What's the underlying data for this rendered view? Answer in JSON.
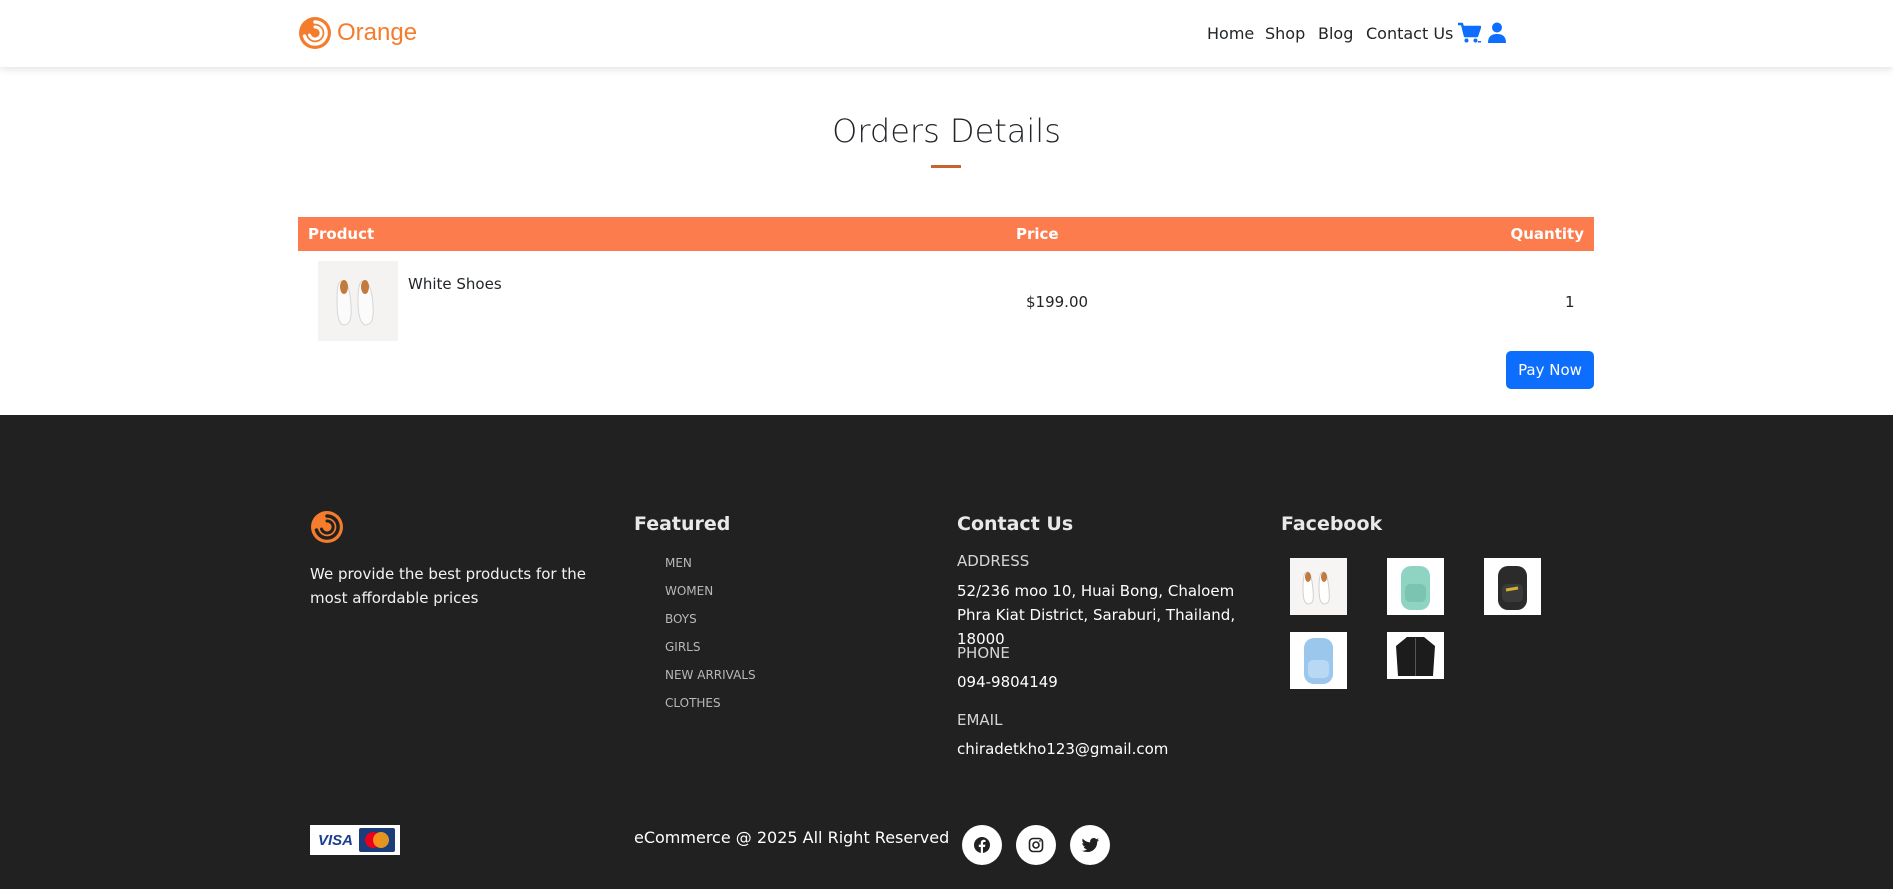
{
  "navbar": {
    "brand": "Orange",
    "links": [
      "Home",
      "Shop",
      "Blog",
      "Contact Us"
    ],
    "icons": [
      "cart-icon",
      "user-icon"
    ],
    "accent_color": "#f47c2c",
    "link_color": "#0d6efd"
  },
  "page": {
    "title": "Orders Details"
  },
  "table": {
    "headers": {
      "product": "Product",
      "price": "Price",
      "quantity": "Quantity"
    },
    "header_color": "#fd7c4d",
    "rows": [
      {
        "product": "White Shoes",
        "price": "$199.00",
        "quantity": "1"
      }
    ],
    "pay_button": "Pay Now"
  },
  "footer": {
    "background": "#212121",
    "description": "We provide the best products for the most affordable prices",
    "featured": {
      "heading": "Featured",
      "items": [
        "MEN",
        "WOMEN",
        "BOYS",
        "GIRLS",
        "NEW ARRIVALS",
        "CLOTHES"
      ]
    },
    "contact": {
      "heading": "Contact Us",
      "address_label": "ADDRESS",
      "address": "52/236 moo 10, Huai Bong, Chaloem Phra Kiat District, Saraburi, Thailand, 18000",
      "phone_label": "PHONE",
      "phone": "094-9804149",
      "email_label": "EMAIL",
      "email": "chiradetkho123@gmail.com"
    },
    "facebook": {
      "heading": "Facebook",
      "thumbnails": [
        "white-shoes",
        "mint-backpack",
        "black-backpack",
        "light-blue-backpack",
        "black-jacket"
      ]
    },
    "copyright": "eCommerce @ 2025 All Right Reserved",
    "social": [
      "facebook-icon",
      "instagram-icon",
      "twitter-icon"
    ],
    "payment_cards": {
      "visa": "VISA",
      "mastercard": "MasterCard"
    }
  }
}
